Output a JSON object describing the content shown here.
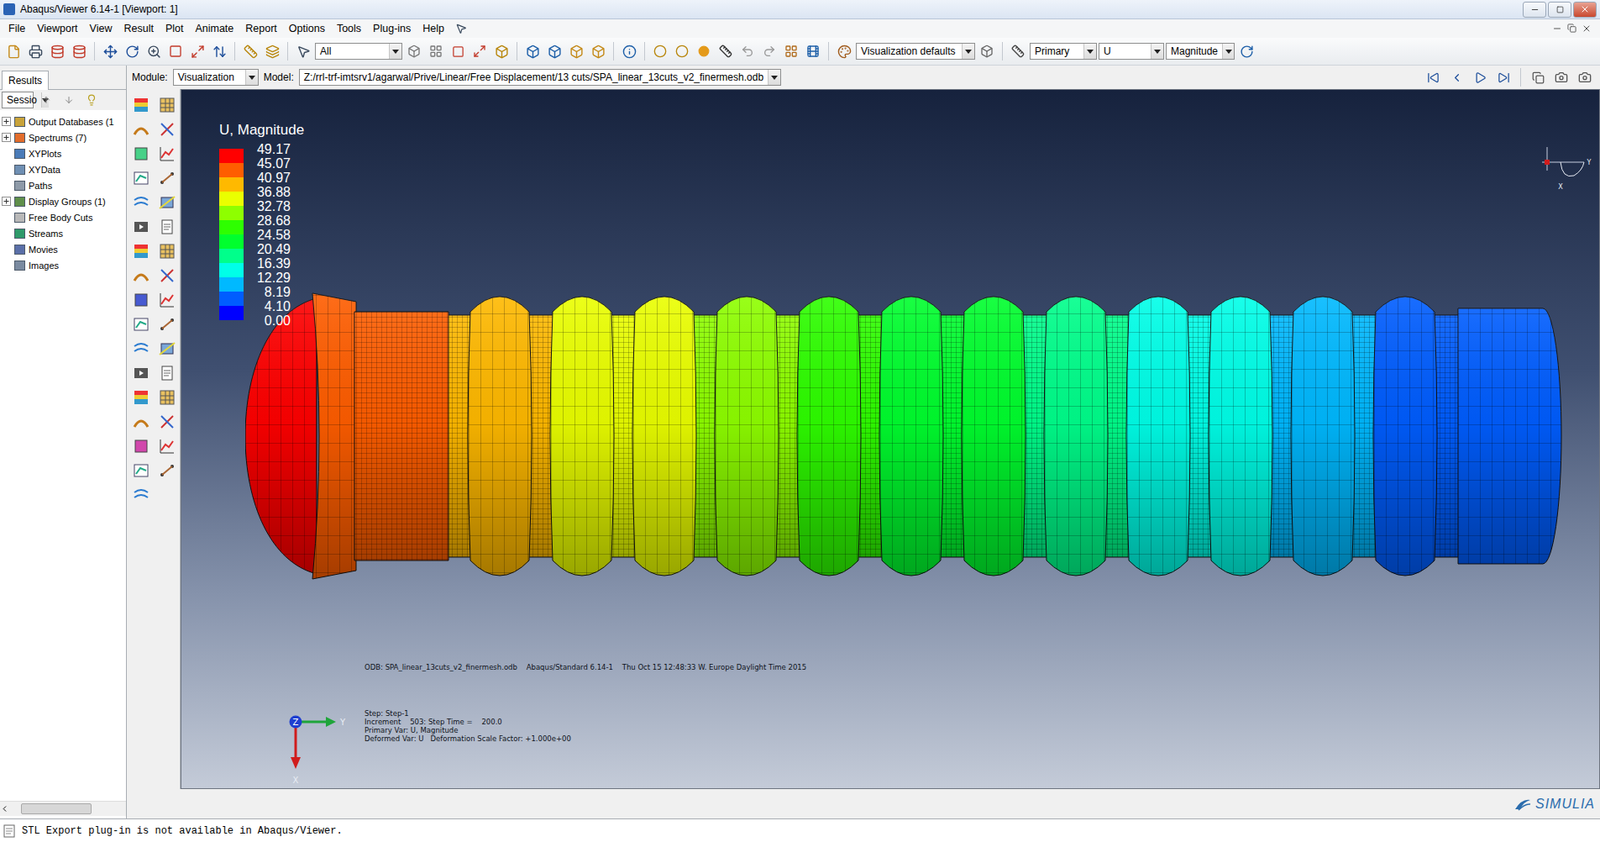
{
  "window": {
    "title": "Abaqus/Viewer 6.14-1 [Viewport: 1]"
  },
  "menu": [
    "File",
    "Viewport",
    "View",
    "Result",
    "Plot",
    "Animate",
    "Report",
    "Options",
    "Tools",
    "Plug-ins",
    "Help"
  ],
  "toolbar": {
    "selection": "All",
    "render_style": "Visualization defaults",
    "variable_type": "Primary",
    "field": "U",
    "invariant": "Magnitude"
  },
  "context_bar": {
    "module_label": "Module:",
    "module": "Visualization",
    "model_label": "Model:",
    "model": "Z:/rrl-trf-imtsrv1/agarwal/Prive/Linear/Free Displacement/13 cuts/SPA_linear_13cuts_v2_finermesh.odb"
  },
  "sidebar": {
    "tab": "Results",
    "session": "Sessio",
    "items": [
      {
        "label": "Output Databases (1",
        "expander": true,
        "expanded": false
      },
      {
        "label": "Spectrums (7)",
        "expander": true,
        "expanded": false
      },
      {
        "label": "XYPlots",
        "expander": false,
        "expanded": false
      },
      {
        "label": "XYData",
        "expander": false,
        "expanded": false
      },
      {
        "label": "Paths",
        "expander": false,
        "expanded": false
      },
      {
        "label": "Display Groups (1)",
        "expander": true,
        "expanded": false
      },
      {
        "label": "Free Body Cuts",
        "expander": false,
        "expanded": false
      },
      {
        "label": "Streams",
        "expander": false,
        "expanded": false
      },
      {
        "label": "Movies",
        "expander": false,
        "expanded": false
      },
      {
        "label": "Images",
        "expander": false,
        "expanded": false
      }
    ]
  },
  "legend": {
    "title": "U, Magnitude",
    "values": [
      "49.17",
      "45.07",
      "40.97",
      "36.88",
      "32.78",
      "28.68",
      "24.58",
      "20.49",
      "16.39",
      "12.29",
      "8.19",
      "4.10",
      "0.00"
    ],
    "colors": [
      "#ff0000",
      "#ff5d00",
      "#ffb900",
      "#eaff00",
      "#8eff00",
      "#2eff00",
      "#00ff2e",
      "#00ff8b",
      "#00ffe8",
      "#00b9ff",
      "#005dff",
      "#0000ff"
    ]
  },
  "viewport": {
    "odb_line": "ODB: SPA_linear_13cuts_v2_finermesh.odb    Abaqus/Standard 6.14-1    Thu Oct 15 12:48:33 W. Europe Daylight Time 2015",
    "step_lines": [
      "Step: Step-1",
      "Increment    503: Step Time =    200.0",
      "Primary Var: U, Magnitude",
      "Deformed Var: U   Deformation Scale Factor: +1.000e+00"
    ],
    "triad": {
      "x": "X",
      "y": "Y",
      "z": "Z"
    },
    "mini_triad": {
      "x": "X",
      "y": "Y"
    }
  },
  "brand": "SIMULIA",
  "message": "STL Export plug-in is not available in Abaqus/Viewer."
}
